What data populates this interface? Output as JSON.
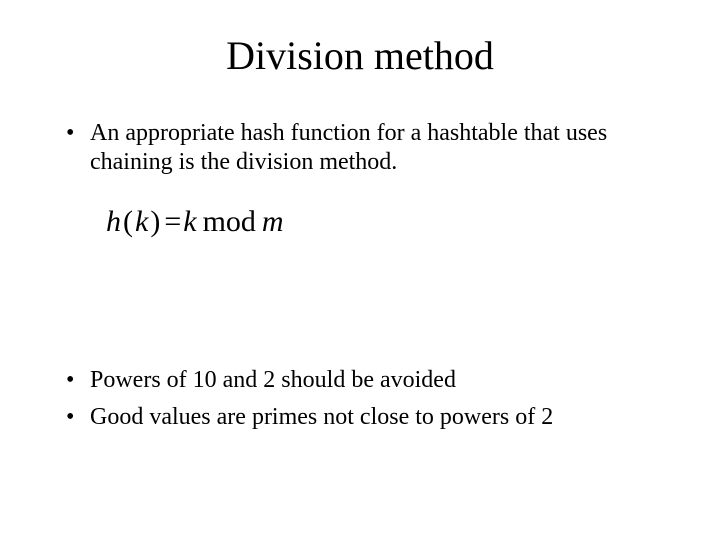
{
  "title": "Division method",
  "bullets_top": [
    "An appropriate hash function for a hashtable that uses chaining is the division method."
  ],
  "formula": {
    "lhs_fn": "h",
    "lhs_arg": "k",
    "rhs_left": "k",
    "operator": "mod",
    "rhs_right": "m"
  },
  "bullets_bottom": [
    "Powers of 10 and 2 should be avoided",
    "Good values are primes not close to powers of 2"
  ]
}
